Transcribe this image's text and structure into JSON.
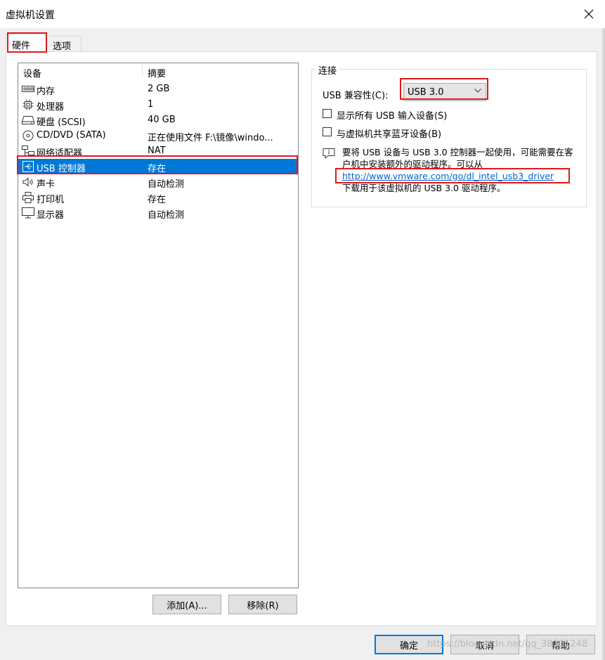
{
  "window": {
    "title": "虚拟机设置"
  },
  "tabs": [
    {
      "label": "硬件"
    },
    {
      "label": "选项"
    }
  ],
  "device_list": {
    "columns": [
      "设备",
      "摘要"
    ],
    "rows": [
      {
        "name": "内存",
        "summary": "2 GB",
        "icon": "memory-icon"
      },
      {
        "name": "处理器",
        "summary": "1",
        "icon": "processor-icon"
      },
      {
        "name": "硬盘 (SCSI)",
        "summary": "40 GB",
        "icon": "harddisk-icon"
      },
      {
        "name": "CD/DVD (SATA)",
        "summary": "正在使用文件 F:\\镜像\\windo...",
        "icon": "cd-dvd-icon"
      },
      {
        "name": "网络适配器",
        "summary": "NAT",
        "icon": "network-adapter-icon"
      },
      {
        "name": "USB 控制器",
        "summary": "存在",
        "icon": "usb-icon",
        "selected": true
      },
      {
        "name": "声卡",
        "summary": "自动检测",
        "icon": "speaker-icon"
      },
      {
        "name": "打印机",
        "summary": "存在",
        "icon": "printer-icon"
      },
      {
        "name": "显示器",
        "summary": "自动检测",
        "icon": "monitor-icon"
      }
    ]
  },
  "buttons": {
    "add": "添加(A)...",
    "remove": "移除(R)",
    "ok": "确定",
    "cancel": "取消",
    "help": "帮助"
  },
  "connection": {
    "group_label": "连接",
    "compat_label": "USB 兼容性(C):",
    "compat_value": "USB 3.0",
    "show_all_usb": "显示所有 USB 输入设备(S)",
    "share_bluetooth": "与虚拟机共享蓝牙设备(B)",
    "info_line1": "要将 USB 设备与 USB 3.0 控制器一起使用，可能需要在客户机中安装额外的驱动程序。可以从",
    "info_link": "http://www.vmware.com/go/dl_intel_usb3_driver",
    "info_line3": "下载用于该虚拟机的 USB 3.0 驱动程序。"
  },
  "watermark": "https://blog.csdn.net/qq_38301248",
  "colors": {
    "selection": "#0078d7",
    "highlight_box": "#e0191f",
    "link": "#0066cc"
  }
}
